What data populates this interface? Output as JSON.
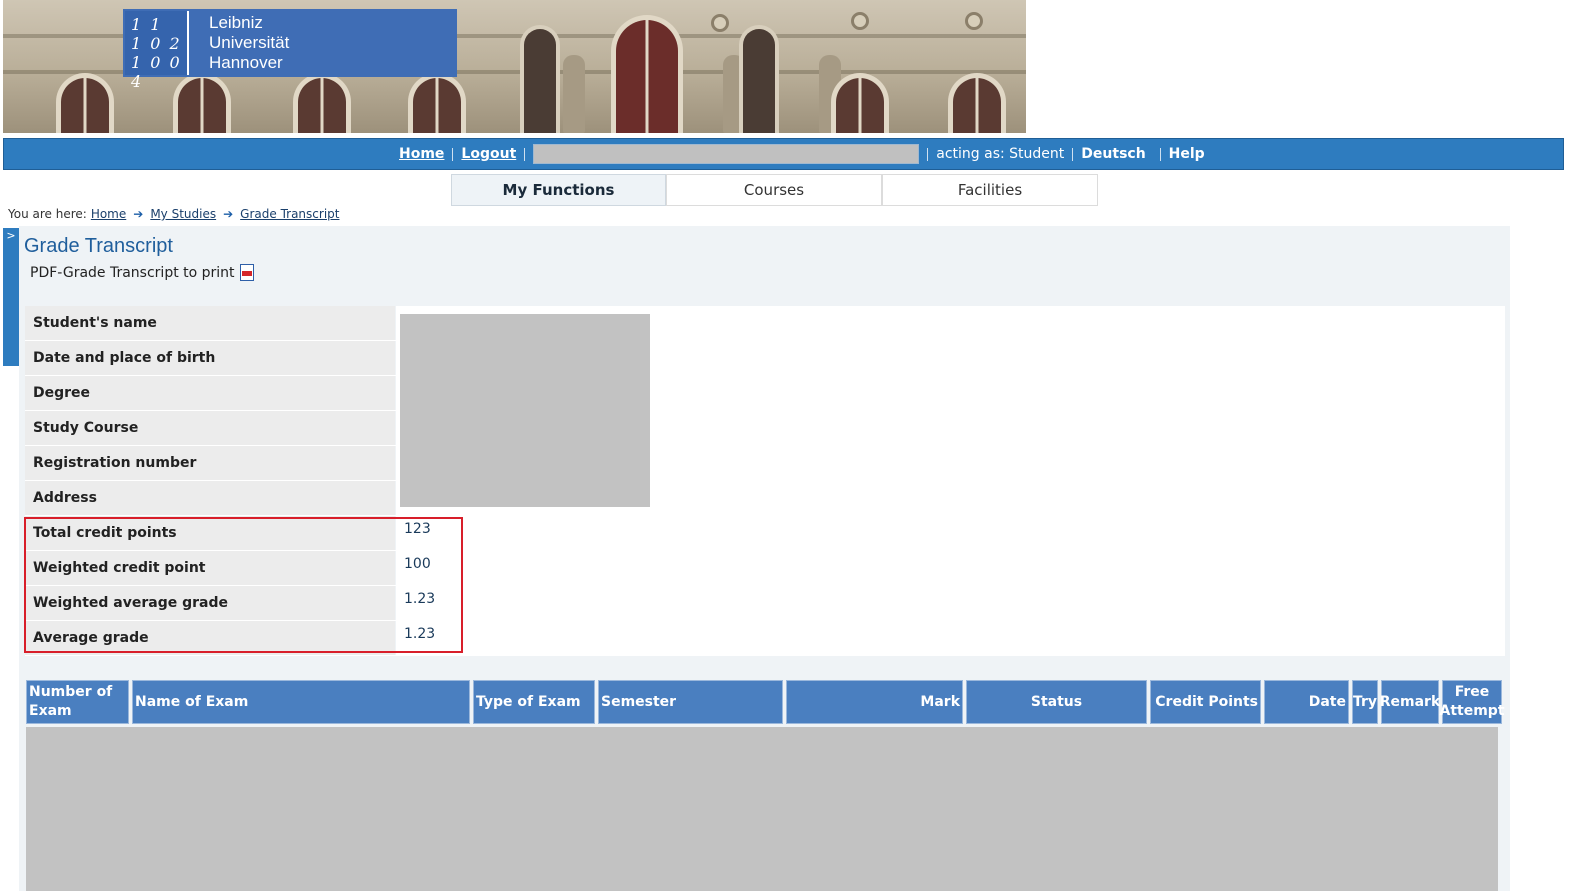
{
  "logo": {
    "mark_lines": [
      "1 1",
      "1 0 2",
      "1 0 0 4"
    ],
    "name_lines": [
      "Leibniz",
      "Universität",
      "Hannover"
    ]
  },
  "topnav": {
    "home": "Home",
    "logout": "Logout",
    "acting_as": "acting as: Student",
    "language": "Deutsch",
    "help": "Help"
  },
  "tabs": [
    {
      "label": "My Functions",
      "active": true
    },
    {
      "label": "Courses",
      "active": false
    },
    {
      "label": "Facilities",
      "active": false
    }
  ],
  "breadcrumb": {
    "prefix": "You are here:",
    "items": [
      "Home",
      "My Studies",
      "Grade Transcript"
    ]
  },
  "sidetoggle": ">",
  "page": {
    "title": "Grade Transcript",
    "pdf_link": "PDF-Grade Transcript to print"
  },
  "info_rows": [
    {
      "label": "Student's name",
      "value": ""
    },
    {
      "label": "Date and place of birth",
      "value": ""
    },
    {
      "label": "Degree",
      "value": ""
    },
    {
      "label": "Study Course",
      "value": ""
    },
    {
      "label": "Registration number",
      "value": ""
    },
    {
      "label": "Address",
      "value": ""
    },
    {
      "label": "Total credit points",
      "value": "123"
    },
    {
      "label": "Weighted credit point",
      "value": "100"
    },
    {
      "label": "Weighted average grade",
      "value": "1.23"
    },
    {
      "label": "Average grade",
      "value": "1.23"
    }
  ],
  "exam_columns": [
    "Number of Exam",
    "Name of Exam",
    "Type of Exam",
    "Semester",
    "Mark",
    "Status",
    "Credit Points",
    "Date",
    "Try",
    "Remark",
    "Free Attempt"
  ],
  "colors": {
    "nav_blue": "#2e7cbf",
    "table_header_blue": "#4a7fc0",
    "highlight_red": "#d81e2a",
    "redacted_gray": "#c2c2c2"
  }
}
